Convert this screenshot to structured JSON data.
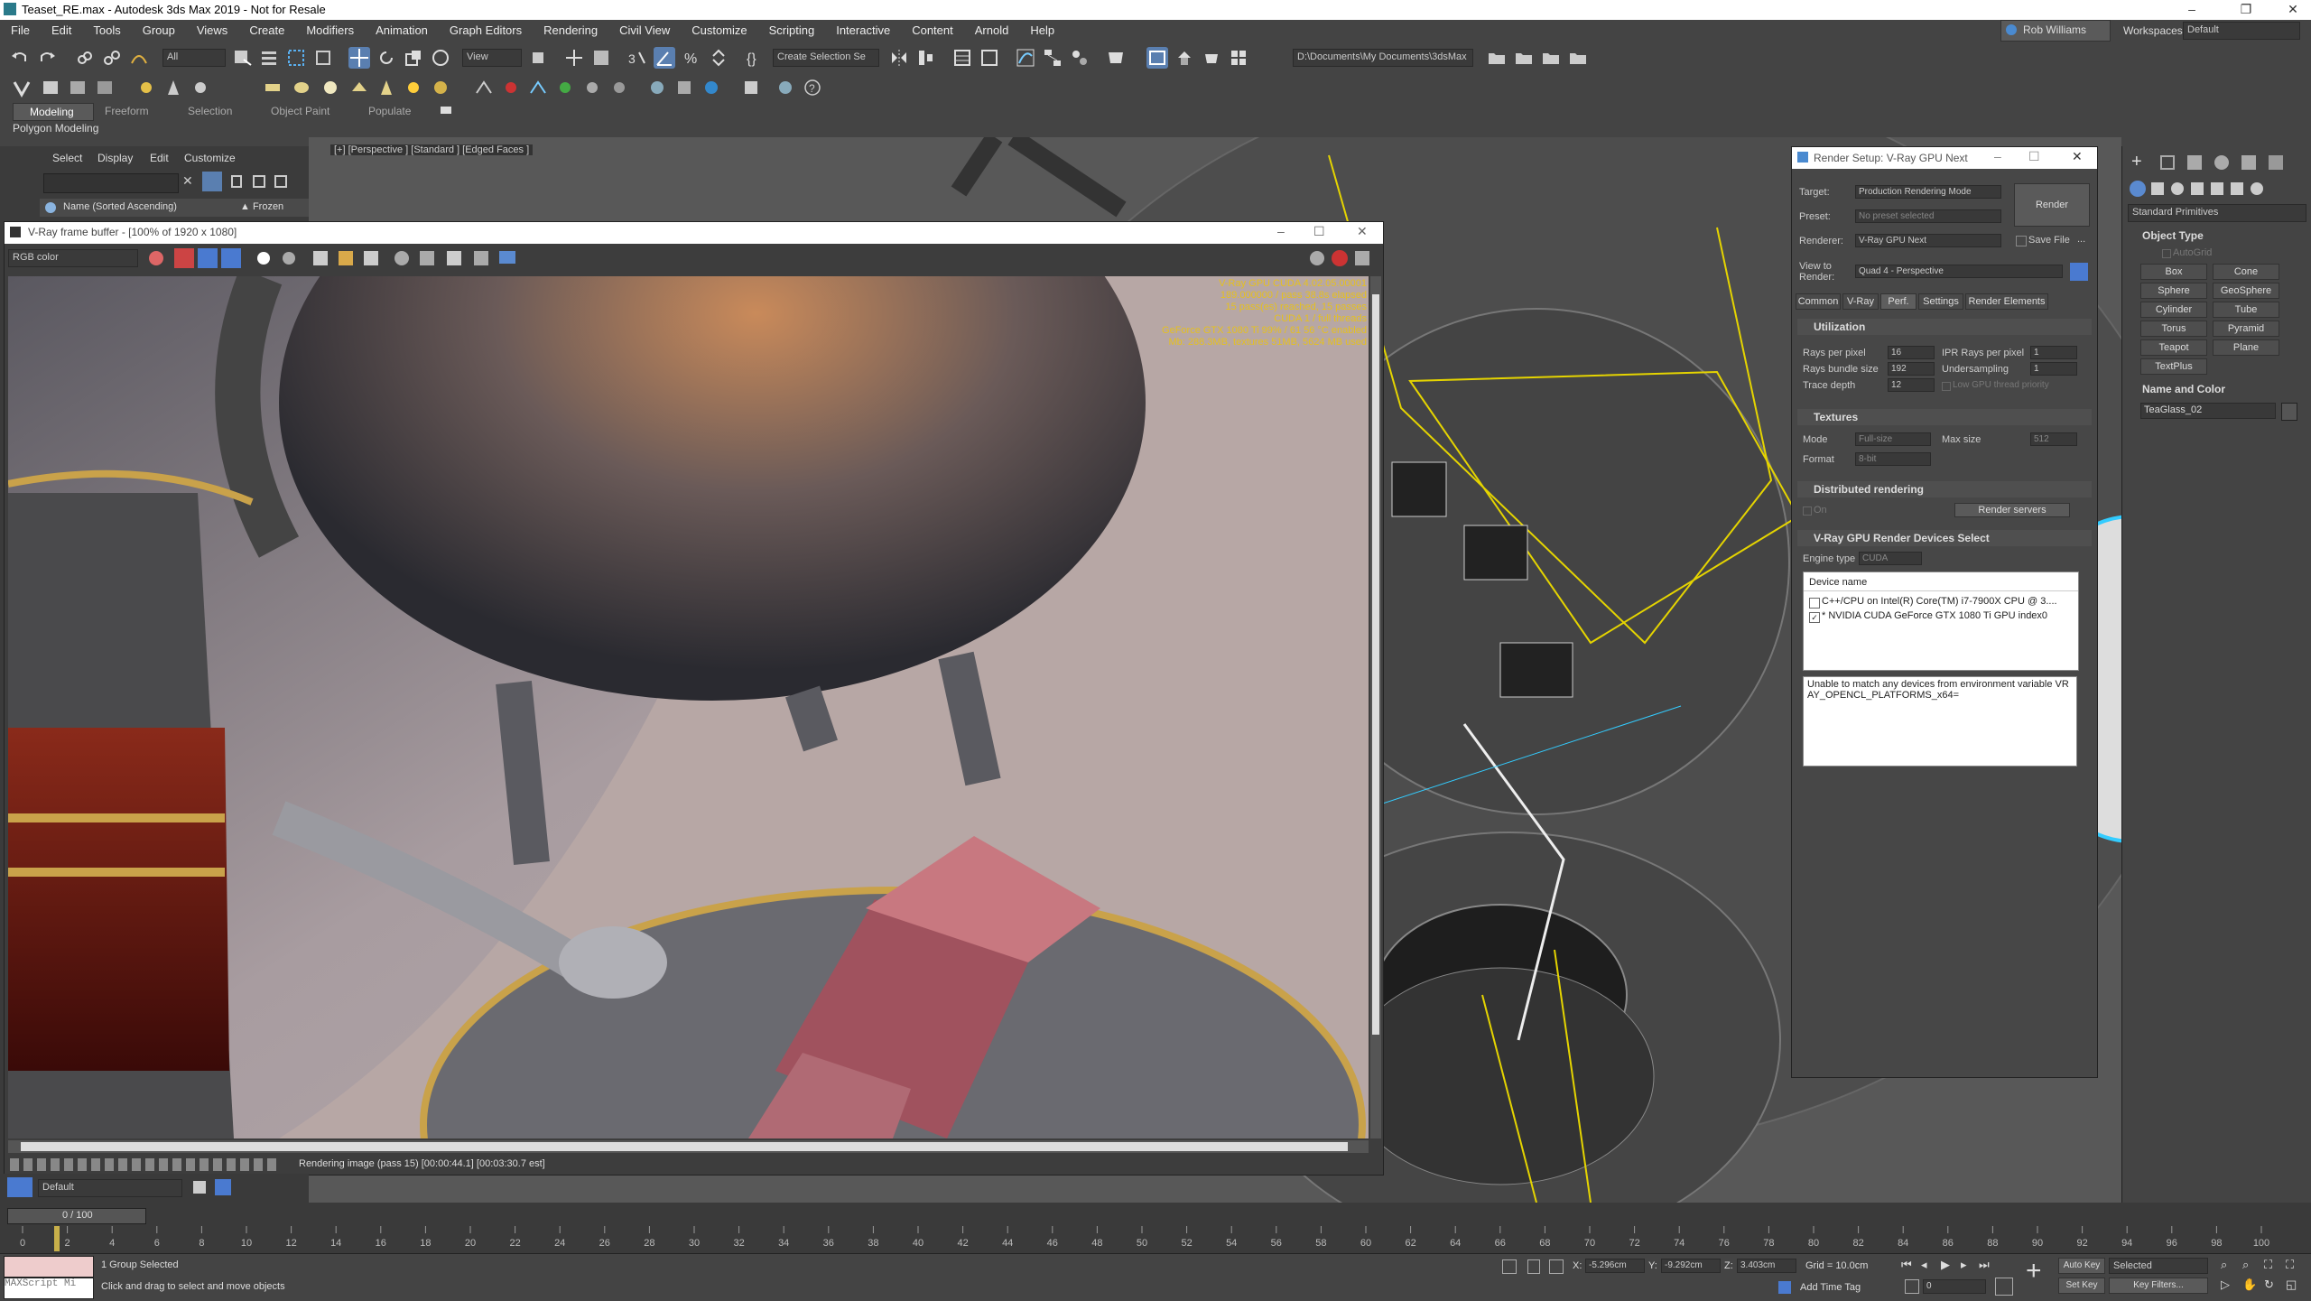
{
  "window": {
    "title": "Teaset_RE.max - Autodesk 3ds Max 2019 - Not for Resale"
  },
  "menu": [
    "File",
    "Edit",
    "Tools",
    "Group",
    "Views",
    "Create",
    "Modifiers",
    "Animation",
    "Graph Editors",
    "Rendering",
    "Civil View",
    "Customize",
    "Scripting",
    "Interactive",
    "Content",
    "Arnold",
    "Help"
  ],
  "user": {
    "name": "Rob Williams",
    "workspaces_label": "Workspaces:",
    "workspace": "Default"
  },
  "toolbar": {
    "selection_filter": "All",
    "view_dropdown": "View",
    "create_selection_set": "Create Selection Se",
    "path": "D:\\Documents\\My Documents\\3dsMax"
  },
  "ribbon": {
    "tabs": [
      "Modeling",
      "Freeform",
      "Selection",
      "Object Paint",
      "Populate"
    ],
    "sub": "Polygon Modeling"
  },
  "scene_explorer": {
    "menu": [
      "Select",
      "Display",
      "Edit",
      "Customize"
    ],
    "column": "Name (Sorted Ascending)",
    "frozen": "▲ Frozen",
    "layer": "Default"
  },
  "viewport": {
    "label": "[+] [Perspective ] [Standard ] [Edged Faces ]"
  },
  "vfb": {
    "title": "V-Ray frame buffer - [100% of 1920 x 1080]",
    "channel": "RGB color",
    "overlay": [
      "V-Ray GPU CUDA 4.02.05.00001",
      "189.000000 / pass 38.8s elapsed",
      "15 pass(es) reached, 15 passes",
      "CUDA 1 / full threads",
      "GeForce GTX 1080 Ti  99% / 61 56 °C enabled",
      "Mb: 288.3MB, textures 51MB, 5624 MB used"
    ],
    "status": "Rendering image (pass 15) [00:00:44.1] [00:03:30.7 est]"
  },
  "render_setup": {
    "title": "Render Setup: V-Ray GPU Next",
    "target_label": "Target:",
    "target": "Production Rendering Mode",
    "preset_label": "Preset:",
    "preset": "No preset selected",
    "renderer_label": "Renderer:",
    "renderer": "V-Ray GPU Next",
    "save_file": "Save File",
    "view_label": "View to\nRender:",
    "view": "Quad 4 - Perspective",
    "render_button": "Render",
    "tabs": [
      "Common",
      "V-Ray",
      "Perf.",
      "Settings",
      "Render Elements"
    ],
    "utilization": {
      "title": "Utilization",
      "rays_per_pixel_label": "Rays per pixel",
      "rays_per_pixel": "16",
      "ipr_rays_label": "IPR Rays per pixel",
      "ipr_rays": "1",
      "bundle_label": "Rays bundle size",
      "bundle": "192",
      "undersampling_label": "Undersampling",
      "undersampling": "1",
      "trace_label": "Trace depth",
      "trace": "12",
      "low_gpu": "Low GPU thread priority"
    },
    "textures": {
      "title": "Textures",
      "mode_label": "Mode",
      "mode": "Full-size",
      "max_label": "Max size",
      "max": "512",
      "format_label": "Format",
      "format": "8-bit"
    },
    "distributed": {
      "title": "Distributed rendering",
      "on": "On",
      "servers": "Render servers"
    },
    "devices": {
      "title": "V-Ray GPU Render Devices Select",
      "engine_label": "Engine type",
      "engine": "CUDA",
      "header": "Device name",
      "list": [
        "C++/CPU on Intel(R) Core(TM) i7-7900X CPU @ 3....",
        "* NVIDIA CUDA GeForce GTX 1080 Ti GPU index0"
      ],
      "message": "Unable to match any devices from environment variable VRAY_OPENCL_PLATFORMS_x64="
    }
  },
  "command_panel": {
    "category": "Standard Primitives",
    "object_type": "Object Type",
    "autogrid": "AutoGrid",
    "buttons": [
      "Box",
      "Cone",
      "Sphere",
      "GeoSphere",
      "Cylinder",
      "Tube",
      "Torus",
      "Pyramid",
      "Teapot",
      "Plane",
      "TextPlus"
    ],
    "name_color": "Name and Color",
    "name": "TeaGlass_02"
  },
  "timeline": {
    "frame": "0 / 100",
    "ticks": [
      "0",
      "2",
      "4",
      "6",
      "8",
      "10",
      "12",
      "14",
      "16",
      "18",
      "20",
      "22",
      "24",
      "26",
      "28",
      "30",
      "32",
      "34",
      "36",
      "38",
      "40",
      "42",
      "44",
      "46",
      "48",
      "50",
      "52",
      "54",
      "56",
      "58",
      "60",
      "62",
      "64",
      "66",
      "68",
      "70",
      "72",
      "74",
      "76",
      "78",
      "80",
      "82",
      "84",
      "86",
      "88",
      "90",
      "92",
      "94",
      "96",
      "98",
      "100"
    ]
  },
  "status": {
    "maxscript": "MAXScript Mi",
    "selected": "1 Group Selected",
    "prompt": "Click and drag to select and move objects",
    "x_label": "X:",
    "x": "-5.296cm",
    "y_label": "Y:",
    "y": "-9.292cm",
    "z_label": "Z:",
    "z": "3.403cm",
    "grid": "Grid = 10.0cm",
    "add_time_tag": "Add Time Tag",
    "auto_key": "Auto Key",
    "set_key": "Set Key",
    "selected_dd": "Selected",
    "key_filters": "Key Filters...",
    "frame_field": "0"
  }
}
